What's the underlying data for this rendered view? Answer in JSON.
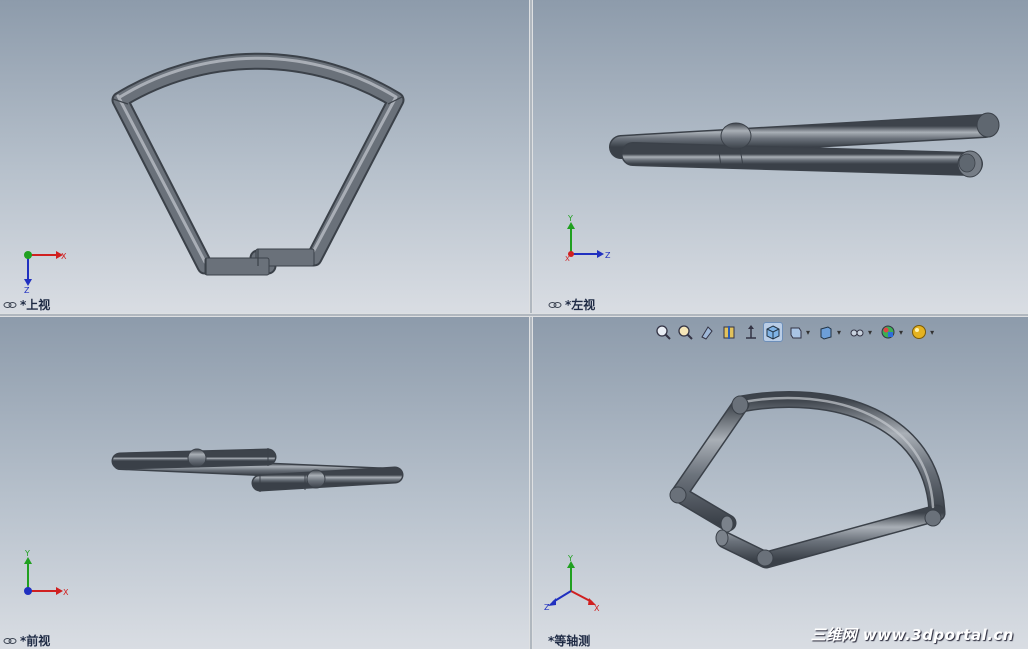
{
  "viewports": {
    "top": {
      "label": "*上视",
      "axes": {
        "h": "X",
        "v": "Z"
      }
    },
    "left": {
      "label": "*左视",
      "axes": {
        "h": "Z",
        "v": "Y",
        "o": "X"
      }
    },
    "front": {
      "label": "*前视",
      "axes": {
        "h": "X",
        "v": "Y"
      }
    },
    "iso": {
      "label": "*等轴测",
      "axes": {
        "h": "X",
        "v": "Y",
        "z": "Z"
      }
    }
  },
  "toolbar": {
    "items": [
      "zoom-to-fit-icon",
      "zoom-to-area-icon",
      "previous-view-icon",
      "section-view-icon",
      "view-orientation-icon",
      "display-style-icon",
      "hide-show-items-icon",
      "edit-appearance-icon",
      "apply-scene-icon",
      "view-settings-icon"
    ]
  },
  "colors": {
    "tube": "#5f6770",
    "tube_highlight": "#c4c9cf",
    "background_top": "#8d9bab",
    "background_bottom": "#d9dde3",
    "axis_x": "#d02020",
    "axis_y": "#20a020",
    "axis_z": "#2030c0"
  },
  "watermark": "三维网 www.3dportal.cn"
}
